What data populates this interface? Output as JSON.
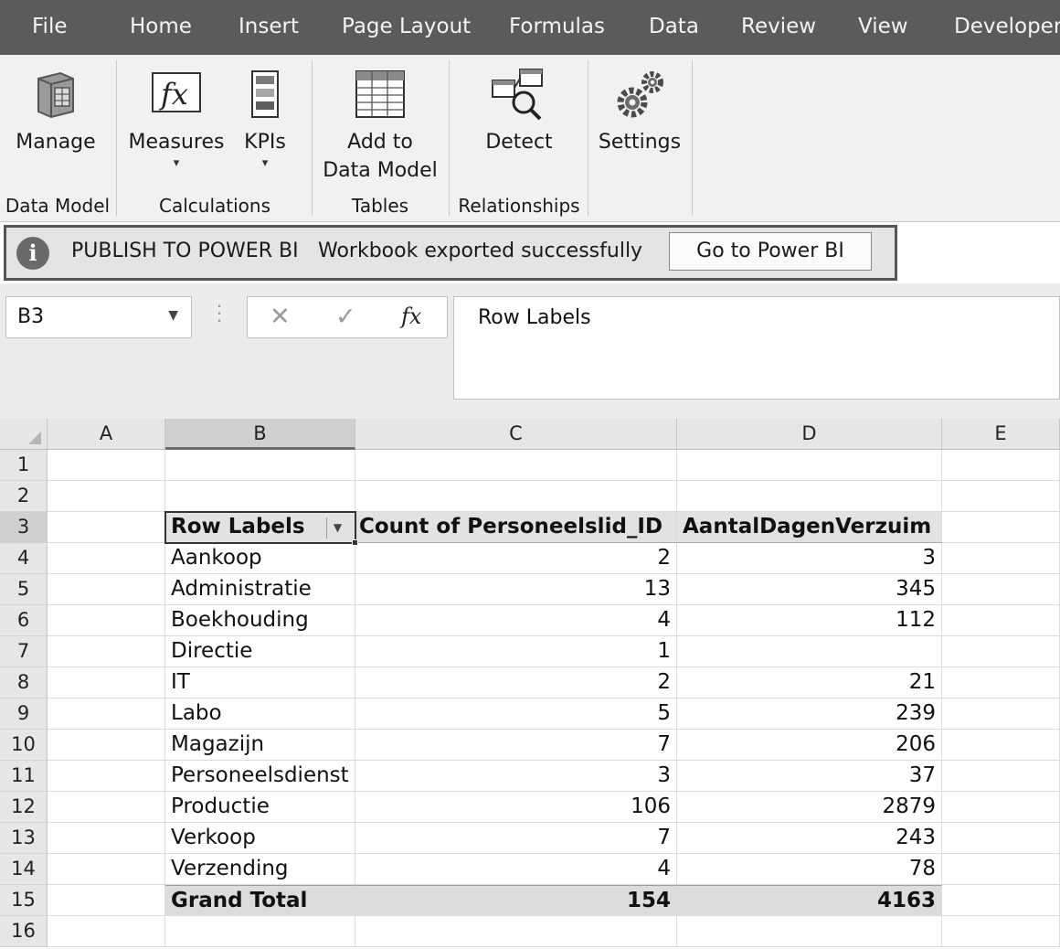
{
  "menu": {
    "tabs": [
      "File",
      "Home",
      "Insert",
      "Page Layout",
      "Formulas",
      "Data",
      "Review",
      "View",
      "Developer"
    ]
  },
  "ribbon": {
    "manage": "Manage",
    "measures": "Measures",
    "kpis": "KPIs",
    "add_to_line1": "Add to",
    "add_to_line2": "Data Model",
    "detect": "Detect",
    "settings": "Settings",
    "groups": {
      "data_model": "Data Model",
      "calculations": "Calculations",
      "tables": "Tables",
      "relationships": "Relationships"
    }
  },
  "notification": {
    "icon": "info-icon",
    "title": "PUBLISH TO POWER BI",
    "message": "Workbook exported successfully",
    "button": "Go to Power BI"
  },
  "formula_bar": {
    "name_box": "B3",
    "content": "Row Labels"
  },
  "sheet": {
    "columns": [
      "A",
      "B",
      "C",
      "D",
      "E"
    ],
    "rows": [
      "1",
      "2",
      "3",
      "4",
      "5",
      "6",
      "7",
      "8",
      "9",
      "10",
      "11",
      "12",
      "13",
      "14",
      "15",
      "16"
    ],
    "pivot": {
      "headers": [
        "Row Labels",
        "Count of Personeelslid_ID",
        "AantalDagenVerzuim"
      ],
      "rows": [
        {
          "label": "Aankoop",
          "count": "2",
          "days": "3"
        },
        {
          "label": "Administratie",
          "count": "13",
          "days": "345"
        },
        {
          "label": "Boekhouding",
          "count": "4",
          "days": "112"
        },
        {
          "label": "Directie",
          "count": "1",
          "days": ""
        },
        {
          "label": "IT",
          "count": "2",
          "days": "21"
        },
        {
          "label": "Labo",
          "count": "5",
          "days": "239"
        },
        {
          "label": "Magazijn",
          "count": "7",
          "days": "206"
        },
        {
          "label": "Personeelsdienst",
          "count": "3",
          "days": "37"
        },
        {
          "label": "Productie",
          "count": "106",
          "days": "2879"
        },
        {
          "label": "Verkoop",
          "count": "7",
          "days": "243"
        },
        {
          "label": "Verzending",
          "count": "4",
          "days": "78"
        }
      ],
      "total": {
        "label": "Grand Total",
        "count": "154",
        "days": "4163"
      }
    }
  }
}
